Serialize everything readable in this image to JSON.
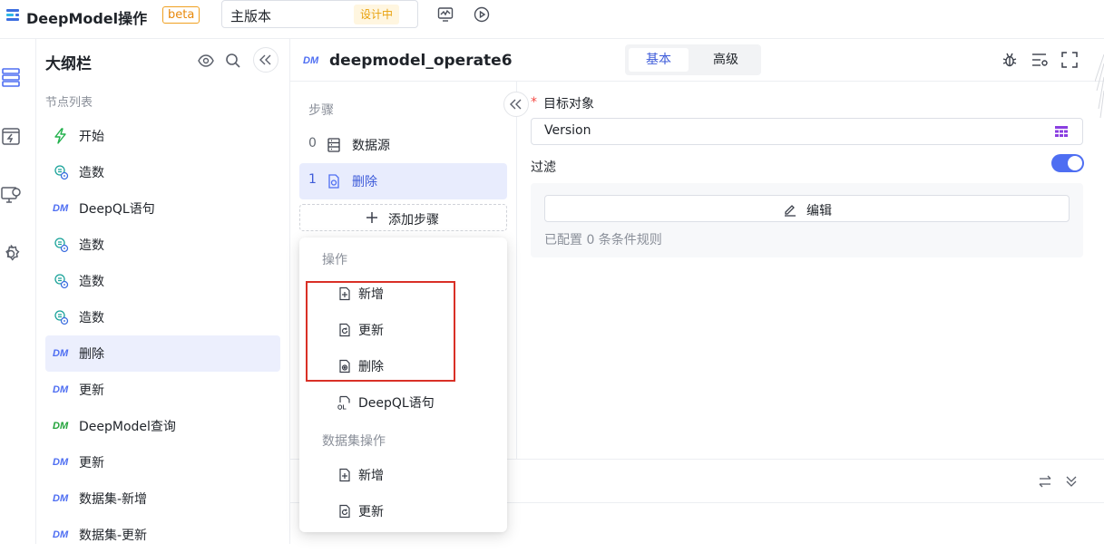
{
  "app": {
    "title": "DeepModel操作",
    "badge": "beta",
    "version_name": "主版本",
    "version_status": "设计中"
  },
  "outline": {
    "title": "大纲栏",
    "section_label": "节点列表",
    "nodes": [
      {
        "label": "开始",
        "icon": "lightning-icon"
      },
      {
        "label": "造数",
        "icon": "data-gen-icon"
      },
      {
        "label": "DeepQL语句",
        "icon": "dm-icon"
      },
      {
        "label": "造数",
        "icon": "data-gen-icon"
      },
      {
        "label": "造数",
        "icon": "data-gen-icon"
      },
      {
        "label": "造数",
        "icon": "data-gen-icon"
      },
      {
        "label": "删除",
        "icon": "dm-icon"
      },
      {
        "label": "更新",
        "icon": "dm-icon"
      },
      {
        "label": "DeepModel查询",
        "icon": "dm-query-icon"
      },
      {
        "label": "更新",
        "icon": "dm-icon"
      },
      {
        "label": "数据集-新增",
        "icon": "dm-icon"
      },
      {
        "label": "数据集-更新",
        "icon": "dm-icon"
      }
    ]
  },
  "main": {
    "title": "deepmodel_operate6",
    "tabs": [
      "基本",
      "高级"
    ],
    "active_tab": "基本"
  },
  "steps": {
    "label": "步骤",
    "items": [
      {
        "num": "0",
        "label": "数据源"
      },
      {
        "num": "1",
        "label": "删除"
      }
    ],
    "add_label": "添加步骤"
  },
  "form": {
    "required_mark": "*",
    "target_label": "目标对象",
    "target_value": "Version",
    "filter_label": "过滤",
    "filter_enabled": true,
    "edit_label": "编辑",
    "rules_text": "已配置 0 条条件规则"
  },
  "dropdown": {
    "group1": "操作",
    "ops": [
      {
        "label": "新增",
        "icon": "file-plus-icon"
      },
      {
        "label": "更新",
        "icon": "file-refresh-icon"
      },
      {
        "label": "删除",
        "icon": "file-delete-icon"
      },
      {
        "label": "DeepQL语句",
        "icon": "ql-icon"
      }
    ],
    "group2": "数据集操作",
    "dataset_ops": [
      {
        "label": "新增",
        "icon": "file-plus-icon"
      },
      {
        "label": "更新",
        "icon": "file-refresh-icon"
      }
    ]
  },
  "colors": {
    "accent": "#4e6ef2",
    "highlight": "#d93026",
    "beta": "#e8890c",
    "lightning": "#22b14c"
  }
}
